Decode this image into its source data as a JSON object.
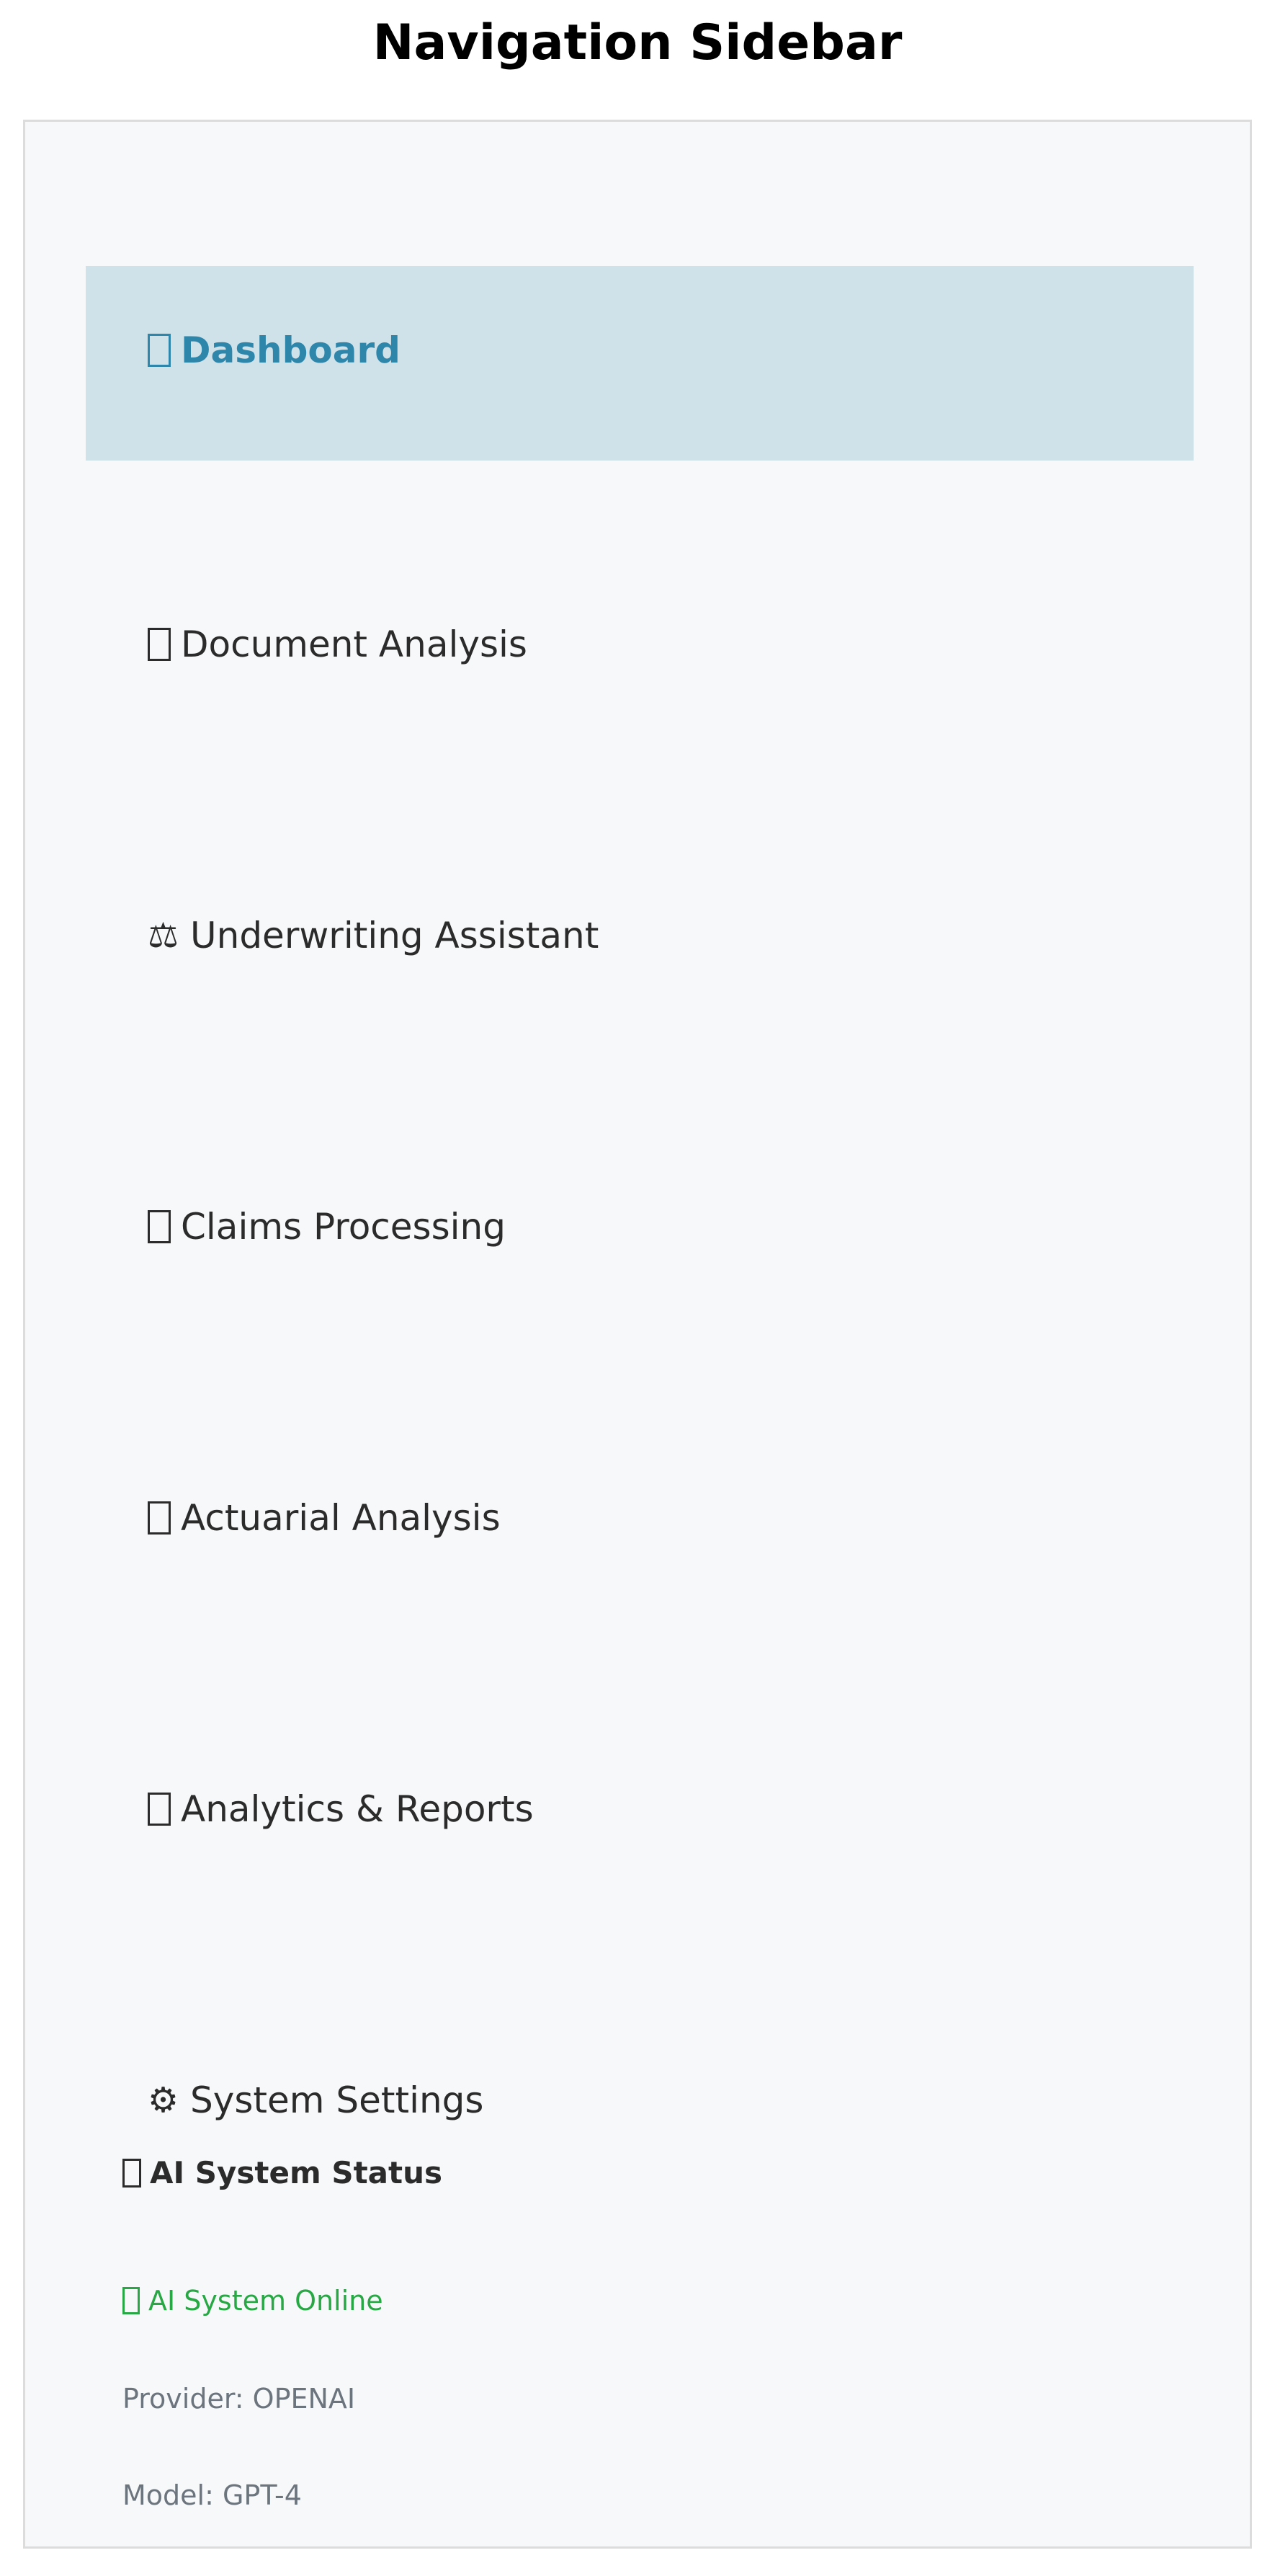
{
  "page": {
    "title": "Navigation Sidebar"
  },
  "sidebar": {
    "items": [
      {
        "label": "Dashboard",
        "icon": "dashboard-icon",
        "active": true
      },
      {
        "label": "Document Analysis",
        "icon": "document-icon",
        "active": false
      },
      {
        "label": "Underwriting Assistant",
        "icon": "scales-icon",
        "glyph": "⚖",
        "active": false
      },
      {
        "label": "Claims Processing",
        "icon": "claims-icon",
        "active": false
      },
      {
        "label": "Actuarial Analysis",
        "icon": "actuarial-icon",
        "active": false
      },
      {
        "label": "Analytics & Reports",
        "icon": "analytics-icon",
        "active": false
      },
      {
        "label": "System Settings",
        "icon": "gear-icon",
        "glyph": "⚙",
        "active": false
      }
    ],
    "status": {
      "title": "AI System Status",
      "online": "AI System Online",
      "provider": "Provider: OPENAI",
      "model": "Model: GPT-4"
    }
  },
  "colors": {
    "active_bg": "#cfe1e9",
    "active_text": "#2e86ab",
    "online": "#28a745",
    "muted": "#6c757d",
    "sidebar_bg": "#f7f8fa"
  }
}
